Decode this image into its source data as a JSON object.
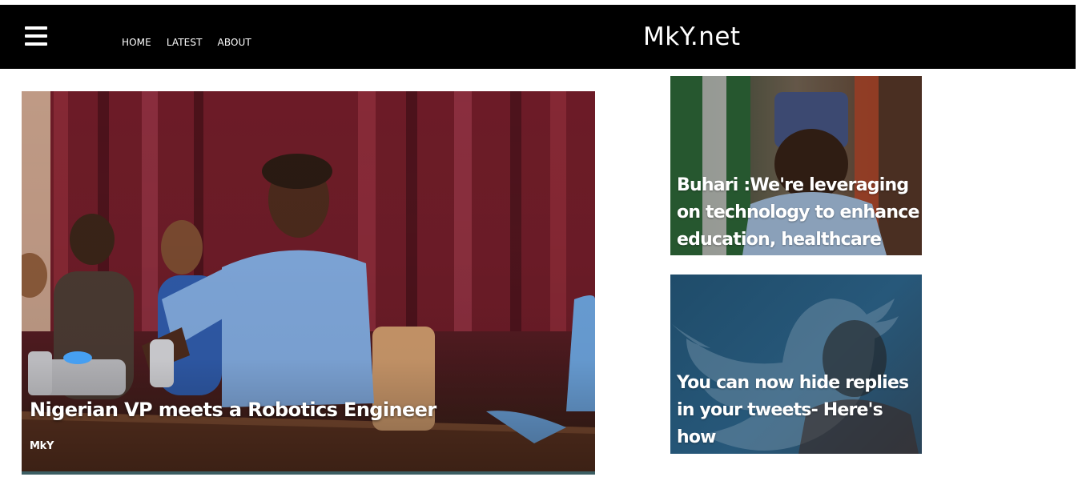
{
  "header": {
    "menu_icon": "hamburger-menu-icon",
    "nav": [
      "HOME",
      "LATEST",
      "ABOUT"
    ],
    "brand": "MkY.net"
  },
  "featured": {
    "title": "Nigerian VP meets a Robotics Engineer",
    "author": "MkY",
    "accent_color": "#3c5e63"
  },
  "side_cards": [
    {
      "title": "Buhari :We're leveraging on technology to enhance education, healthcare"
    },
    {
      "title": "You can now hide replies in your tweets- Here's how"
    }
  ]
}
